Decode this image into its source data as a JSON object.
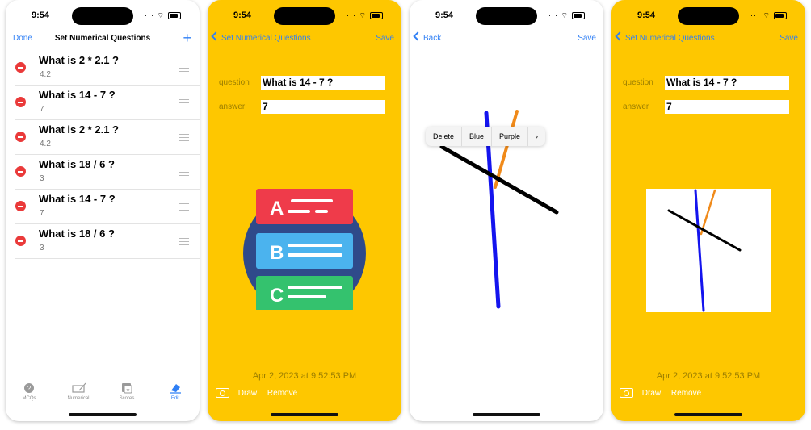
{
  "status": {
    "time": "9:54"
  },
  "screen1": {
    "nav": {
      "left": "Done",
      "title": "Set Numerical Questions",
      "right": "+"
    },
    "questions": [
      {
        "q": "What is 2 * 2.1 ?",
        "a": "4.2"
      },
      {
        "q": "What is 14 - 7 ?",
        "a": "7"
      },
      {
        "q": "What is 2 * 2.1 ?",
        "a": "4.2"
      },
      {
        "q": "What is 18 / 6 ?",
        "a": "3"
      },
      {
        "q": "What is 14 - 7 ?",
        "a": "7"
      },
      {
        "q": "What is 18 / 6 ?",
        "a": "3"
      }
    ],
    "tabs": [
      {
        "label": "MCQs",
        "icon": "mcq-icon"
      },
      {
        "label": "Numerical",
        "icon": "numerical-icon"
      },
      {
        "label": "Scores",
        "icon": "scores-icon"
      },
      {
        "label": "Edit",
        "icon": "eraser-icon"
      }
    ]
  },
  "screen2": {
    "nav": {
      "back": "Set Numerical Questions",
      "right": "Save"
    },
    "question_label": "question",
    "question_value": "What is 14 - 7 ?",
    "answer_label": "answer",
    "answer_value": "7",
    "date": "Apr 2, 2023 at 9:52:53 PM",
    "toolbar": {
      "draw": "Draw",
      "remove": "Remove"
    },
    "illustration_letters": [
      "A",
      "B",
      "C"
    ]
  },
  "screen3": {
    "nav": {
      "back": "Back",
      "right": "Save"
    },
    "menu": [
      "Delete",
      "Blue",
      "Purple",
      "›"
    ]
  },
  "screen4": {
    "nav": {
      "back": "Set Numerical Questions",
      "right": "Save"
    },
    "question_label": "question",
    "question_value": "What is 14 - 7 ?",
    "answer_label": "answer",
    "answer_value": "7",
    "date": "Apr 2, 2023 at 9:52:53 PM",
    "toolbar": {
      "draw": "Draw",
      "remove": "Remove"
    }
  },
  "colors": {
    "accent": "#2f7ff5",
    "yellow": "#fec700",
    "delete_red": "#ea3a3a",
    "stroke_blue": "#1414ee",
    "stroke_orange": "#f08a1a",
    "stroke_black": "#000000"
  }
}
